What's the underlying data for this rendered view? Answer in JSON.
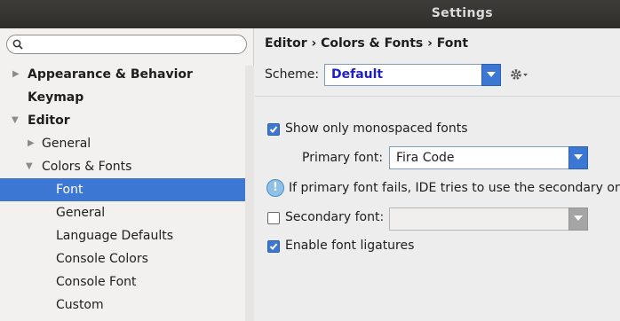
{
  "window": {
    "title": "Settings"
  },
  "search": {
    "value": "",
    "placeholder": ""
  },
  "sidebar": {
    "items": [
      {
        "label": "Appearance & Behavior"
      },
      {
        "label": "Keymap"
      },
      {
        "label": "Editor"
      },
      {
        "label": "General"
      },
      {
        "label": "Colors & Fonts"
      },
      {
        "label": "Font"
      },
      {
        "label": "General"
      },
      {
        "label": "Language Defaults"
      },
      {
        "label": "Console Colors"
      },
      {
        "label": "Console Font"
      },
      {
        "label": "Custom"
      }
    ],
    "selected": "Font"
  },
  "breadcrumb": "Editor › Colors & Fonts › Font",
  "scheme": {
    "label": "Scheme:",
    "value": "Default"
  },
  "options": {
    "show_monospaced": {
      "label": "Show only monospaced fonts",
      "checked": true
    },
    "primary_font": {
      "label": "Primary font:",
      "value": "Fira Code"
    },
    "info_text": "If primary font fails, IDE tries to use the secondary one",
    "secondary_font": {
      "label": "Secondary font:",
      "value": "",
      "checked": false
    },
    "ligatures": {
      "label": "Enable font ligatures",
      "checked": true
    }
  },
  "colors": {
    "accent": "#3d77d4",
    "title_bar": "#2f2e2b",
    "scheme_text": "#1f1fc8"
  }
}
